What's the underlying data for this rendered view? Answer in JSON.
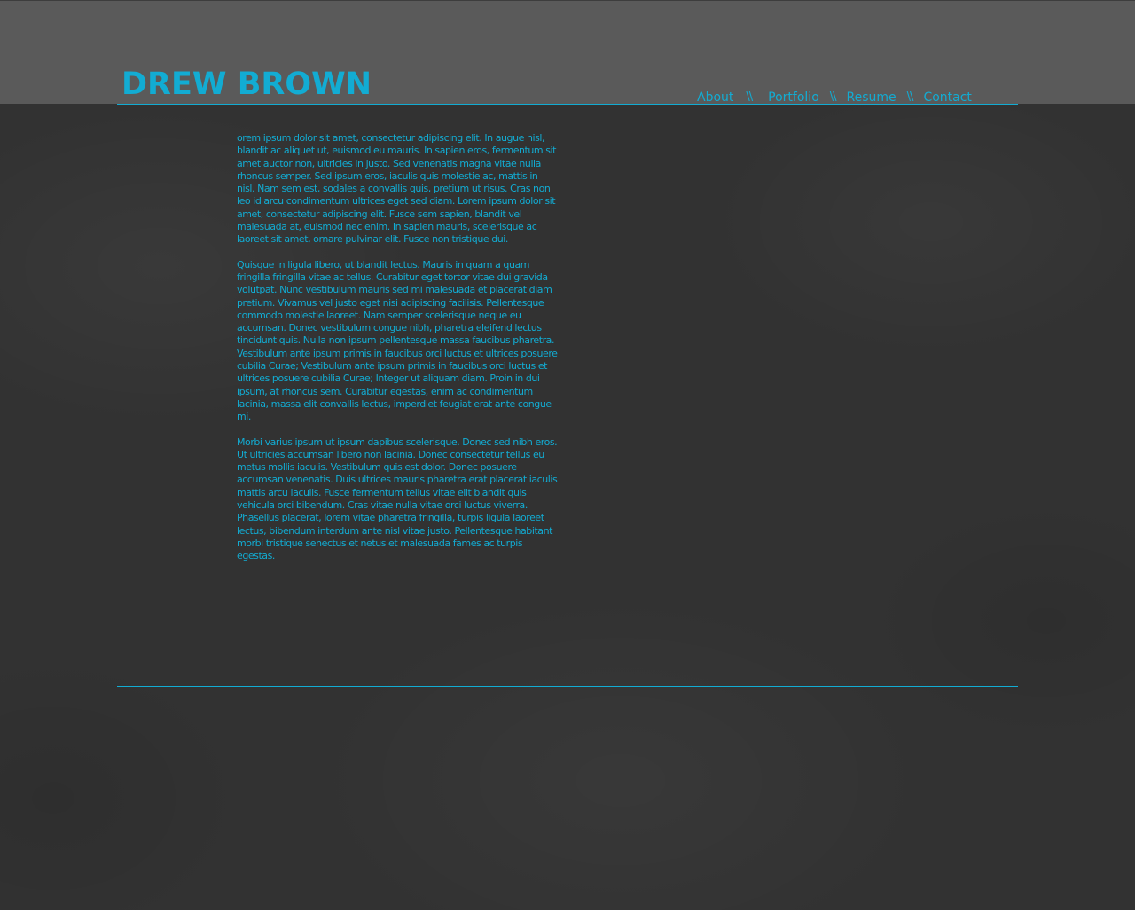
{
  "site": {
    "title": "DREW BROWN"
  },
  "nav": {
    "items": [
      {
        "label": "About"
      },
      {
        "label": "Portfolio"
      },
      {
        "label": "Resume"
      },
      {
        "label": "Contact"
      }
    ],
    "separator": "\\\\"
  },
  "content": {
    "paragraphs": [
      "orem ipsum dolor sit amet, consectetur adipiscing elit. In augue nisl, blandit ac aliquet ut, euismod eu mauris. In sapien eros, fermentum sit amet auctor non, ultricies in justo. Sed venenatis magna vitae nulla rhoncus semper. Sed ipsum eros, iaculis quis molestie ac, mattis in nisl. Nam sem est, sodales a convallis quis, pretium ut risus. Cras non leo id arcu condimentum ultrices eget sed diam. Lorem ipsum dolor sit amet, consectetur adipiscing elit. Fusce sem sapien, blandit vel malesuada at, euismod nec enim. In sapien mauris, scelerisque ac laoreet sit amet, ornare pulvinar elit. Fusce non tristique dui.",
      "Quisque in ligula libero, ut blandit lectus. Mauris in quam a quam fringilla fringilla vitae ac tellus. Curabitur eget tortor vitae dui gravida volutpat. Nunc vestibulum mauris sed mi malesuada et placerat diam pretium. Vivamus vel justo eget nisi adipiscing facilisis. Pellentesque commodo molestie laoreet. Nam semper scelerisque neque eu accumsan. Donec vestibulum congue nibh, pharetra eleifend lectus tincidunt quis. Nulla non ipsum pellentesque massa faucibus pharetra. Vestibulum ante ipsum primis in faucibus orci luctus et ultrices posuere cubilia Curae; Vestibulum ante ipsum primis in faucibus orci luctus et ultrices posuere cubilia Curae; Integer ut aliquam diam. Proin in dui ipsum, at rhoncus sem. Curabitur egestas, enim ac condimentum lacinia, massa elit convallis lectus, imperdiet feugiat erat ante congue mi.",
      "Morbi varius ipsum ut ipsum dapibus scelerisque. Donec sed nibh eros. Ut ultricies accumsan libero non lacinia. Donec consectetur tellus eu metus mollis iaculis. Vestibulum quis est dolor. Donec posuere accumsan venenatis. Duis ultrices mauris pharetra erat placerat iaculis mattis arcu iaculis. Fusce fermentum tellus vitae elit blandit quis vehicula orci bibendum. Cras vitae nulla vitae orci luctus viverra. Phasellus placerat, lorem vitae pharetra fringilla, turpis ligula laoreet lectus, bibendum interdum ante nisl vitae justo. Pellentesque habitant morbi tristique senectus et netus et malesuada fames ac turpis egestas."
    ]
  },
  "colors": {
    "accent": "#12acd3",
    "header_band": "#5a5a5a",
    "background": "#323232"
  }
}
